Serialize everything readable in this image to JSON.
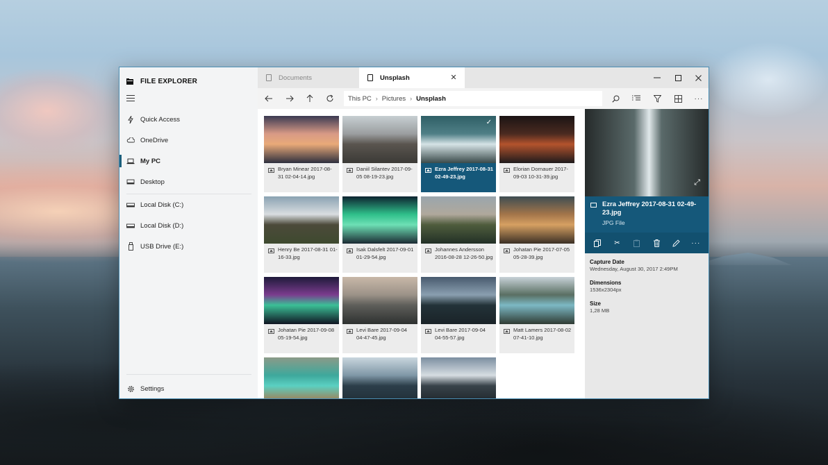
{
  "app": {
    "title": "FILE EXPLORER"
  },
  "sidebar": {
    "items": [
      {
        "label": "Quick Access",
        "icon": "lightning-icon"
      },
      {
        "label": "OneDrive",
        "icon": "cloud-icon"
      },
      {
        "label": "My PC",
        "icon": "laptop-icon",
        "active": true
      },
      {
        "label": "Desktop",
        "icon": "desktop-icon"
      },
      {
        "label": "Local Disk (C:)",
        "icon": "drive-icon"
      },
      {
        "label": "Local Disk (D:)",
        "icon": "drive-icon"
      },
      {
        "label": "USB Drive (E:)",
        "icon": "usb-icon"
      }
    ],
    "settings_label": "Settings"
  },
  "tabs": [
    {
      "label": "Documents",
      "active": false
    },
    {
      "label": "Unsplash",
      "active": true
    }
  ],
  "breadcrumb": {
    "parts": [
      "This PC",
      "Pictures",
      "Unsplash"
    ]
  },
  "files": [
    {
      "name": "Bryan Minear 2017-08-31 02-04-14.jpg",
      "colors": [
        "#3b3a52",
        "#d89a86",
        "#e8a978",
        "#2d2f3e"
      ]
    },
    {
      "name": "Daniil Silantev 2017-09-05 08-19-23.jpg",
      "colors": [
        "#c7cfd2",
        "#9b9ea0",
        "#5a554f",
        "#3b3a36"
      ]
    },
    {
      "name": "Ezra Jeffrey 2017-08-31 02-49-23.jpg",
      "colors": [
        "#2f5f66",
        "#4f7f86",
        "#d5e3e6",
        "#3a4a4a"
      ],
      "selected": true
    },
    {
      "name": "Elorian Dornauer 2017-09-03 10-31-39.jpg",
      "colors": [
        "#1b1414",
        "#4a2a20",
        "#b3532d",
        "#1f1b1c"
      ]
    },
    {
      "name": "Henry Be 2017-08-31 01-16-33.jpg",
      "colors": [
        "#8aa2b2",
        "#d9dde0",
        "#4c4a3a",
        "#3e4a2f"
      ]
    },
    {
      "name": "Isak Dalsfelt 2017-09-01 01-29-54.jpg",
      "colors": [
        "#0d2330",
        "#2fbf8a",
        "#6de0b5",
        "#1b2a33"
      ]
    },
    {
      "name": "Johannes Andersson 2016-08-28 12-26-50.jpg",
      "colors": [
        "#9aa6ad",
        "#b0a89c",
        "#4f5d3d",
        "#223026"
      ]
    },
    {
      "name": "Johatan Pie 2017-07-05 05-28-39.jpg",
      "colors": [
        "#3e4d52",
        "#a3754a",
        "#d6a062",
        "#3b3025"
      ]
    },
    {
      "name": "Johatan Pie 2017-09-08 05-19-54.jpg",
      "colors": [
        "#1e1a3a",
        "#7b3c8e",
        "#3bbf96",
        "#101422"
      ]
    },
    {
      "name": "Levi Bare 2017-09-04 04-47-45.jpg",
      "colors": [
        "#c8b8a8",
        "#9c9288",
        "#5e5e5a",
        "#2e3130"
      ]
    },
    {
      "name": "Levi Bare 2017-09-04 04-55-57.jpg",
      "colors": [
        "#485a6e",
        "#8a9fb0",
        "#233238",
        "#1a2328"
      ]
    },
    {
      "name": "Matt Lamers 2017-08-02 07-41-10.jpg",
      "colors": [
        "#c8d2d8",
        "#5a6f63",
        "#7cb8c4",
        "#2f3b33"
      ]
    },
    {
      "name": "",
      "colors": [
        "#8b9a88",
        "#3ea89c",
        "#5bd0c2",
        "#b36a3a"
      ]
    },
    {
      "name": "",
      "colors": [
        "#c9d6de",
        "#7f97a6",
        "#2c3e4a",
        "#1f2d35"
      ]
    },
    {
      "name": "",
      "colors": [
        "#7b8ea0",
        "#d6dde2",
        "#39434a",
        "#1b2328"
      ]
    }
  ],
  "preview": {
    "title": "Ezra Jeffrey 2017-08-31 02-49-23.jpg",
    "type": "JPG File",
    "colors": [
      "#262b2b",
      "#5a6a6a",
      "#e0e8ea",
      "#30382f"
    ],
    "meta": [
      {
        "label": "Capture Date",
        "value": "Wednesday, August 30, 2017 2:49PM"
      },
      {
        "label": "Dimensions",
        "value": "1536x2304px"
      },
      {
        "label": "Size",
        "value": "1,28 MB"
      }
    ]
  },
  "colors": {
    "accent": "#15587a",
    "accent_dark": "#12506f",
    "window_border": "#4b8fb5"
  }
}
